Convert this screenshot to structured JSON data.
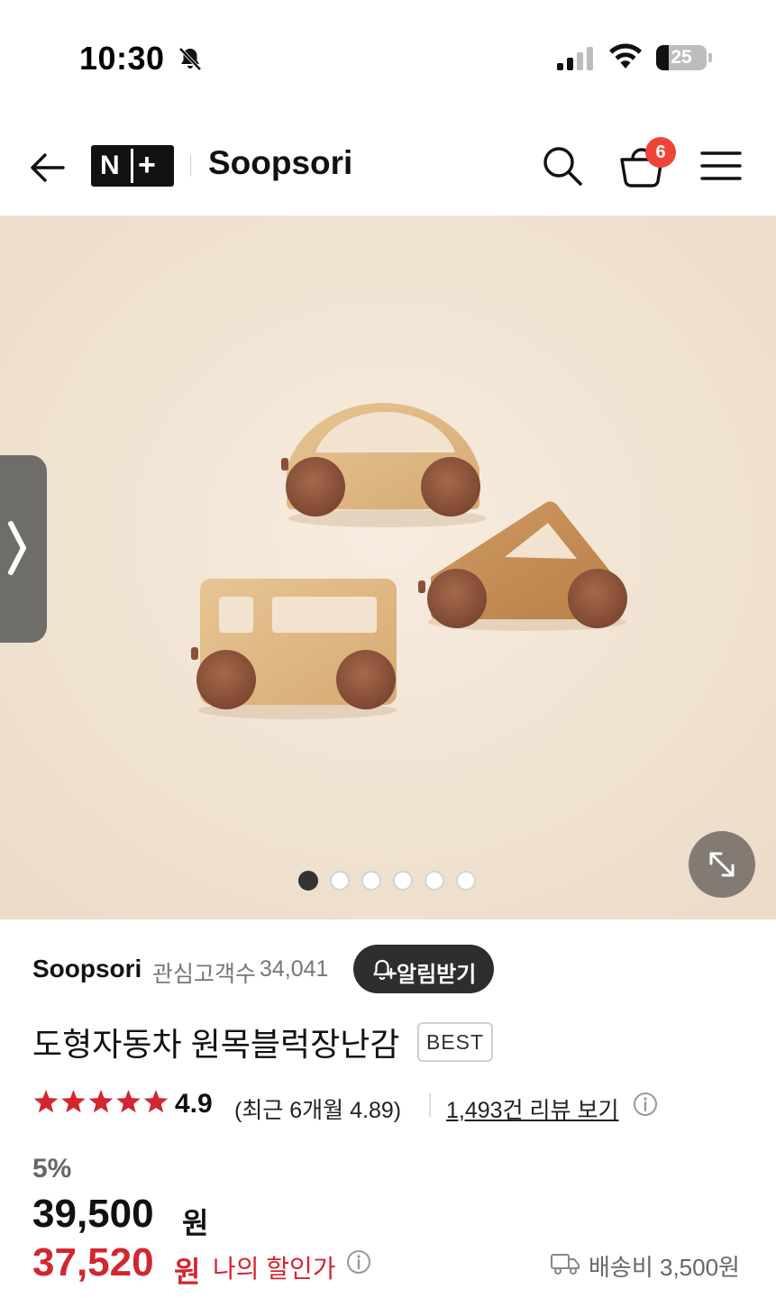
{
  "status_bar": {
    "time": "10:30",
    "battery_level": "25",
    "battery_fraction": 0.25,
    "icons": [
      "bell-slash-icon",
      "cellular-signal-icon",
      "wifi-icon",
      "battery-icon"
    ]
  },
  "header": {
    "logo_n": "N",
    "logo_plus": "+",
    "store_name": "Soopsori",
    "cart_count": "6",
    "icons": [
      "back-arrow-icon",
      "search-icon",
      "shopping-basket-icon",
      "hamburger-menu-icon"
    ]
  },
  "gallery": {
    "page_count": 6,
    "active_index": 0,
    "icons": [
      "chevron-right-icon",
      "expand-diagonal-icon"
    ]
  },
  "seller": {
    "name": "Soopsori",
    "follower_label": "관심고객수",
    "follower_count": "34,041",
    "notify_label": "알림받기"
  },
  "product": {
    "title": "도형자동차 원목블럭장난감",
    "badge": "BEST",
    "rating": "4.9",
    "stars": 5,
    "recent_rating": "(최근 6개월 4.89)",
    "review_link": "1,493건 리뷰 보기"
  },
  "price": {
    "discount_rate": "5%",
    "original": "39,500",
    "original_unit": "원",
    "sale": "37,520",
    "sale_unit": "원",
    "my_price_label": "나의 할인가",
    "shipping": "배송비 3,500원"
  },
  "colors": {
    "sale_red": "#d3262e",
    "badge_red": "#f04438",
    "hero_bg": "#f3e6d6"
  }
}
